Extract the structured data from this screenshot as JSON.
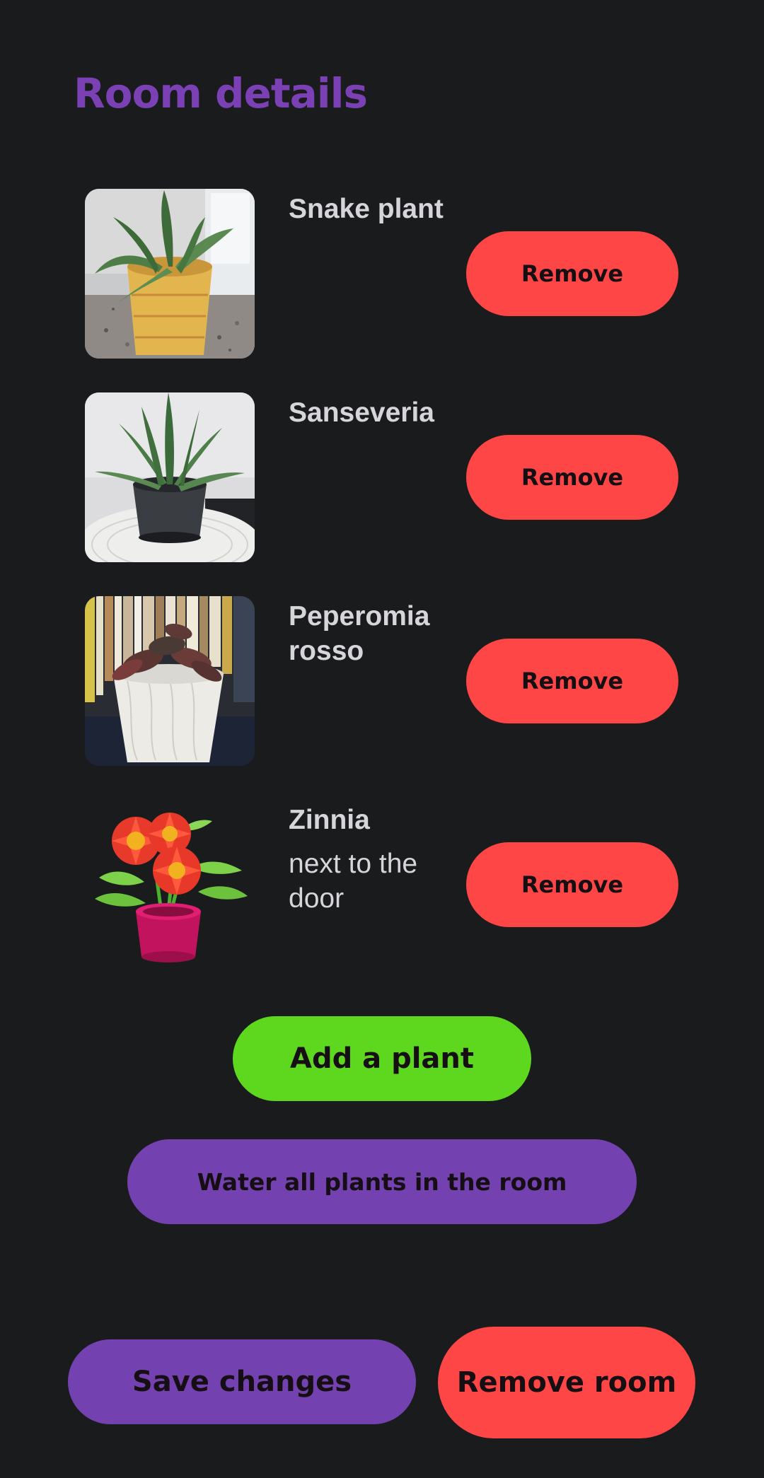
{
  "header": {
    "title": "Room details"
  },
  "plants": [
    {
      "name": "Snake plant",
      "note": "",
      "remove_label": "Remove",
      "image": "snake-plant-photo"
    },
    {
      "name": "Sanseveria",
      "note": "",
      "remove_label": "Remove",
      "image": "sanseveria-photo"
    },
    {
      "name": "Peperomia rosso",
      "note": "",
      "remove_label": "Remove",
      "image": "peperomia-photo"
    },
    {
      "name": "Zinnia",
      "note": "next to the door",
      "remove_label": "Remove",
      "image": "zinnia-illustration"
    }
  ],
  "actions": {
    "add_plant": "Add a plant",
    "water_all": "Water all plants in the room",
    "save_changes": "Save changes",
    "remove_room": "Remove room"
  },
  "colors": {
    "background": "#1a1b1d",
    "title": "#7a40b4",
    "text": "#d6d5da",
    "remove": "#ff4646",
    "add": "#5ed81e",
    "primary": "#7441b0"
  }
}
